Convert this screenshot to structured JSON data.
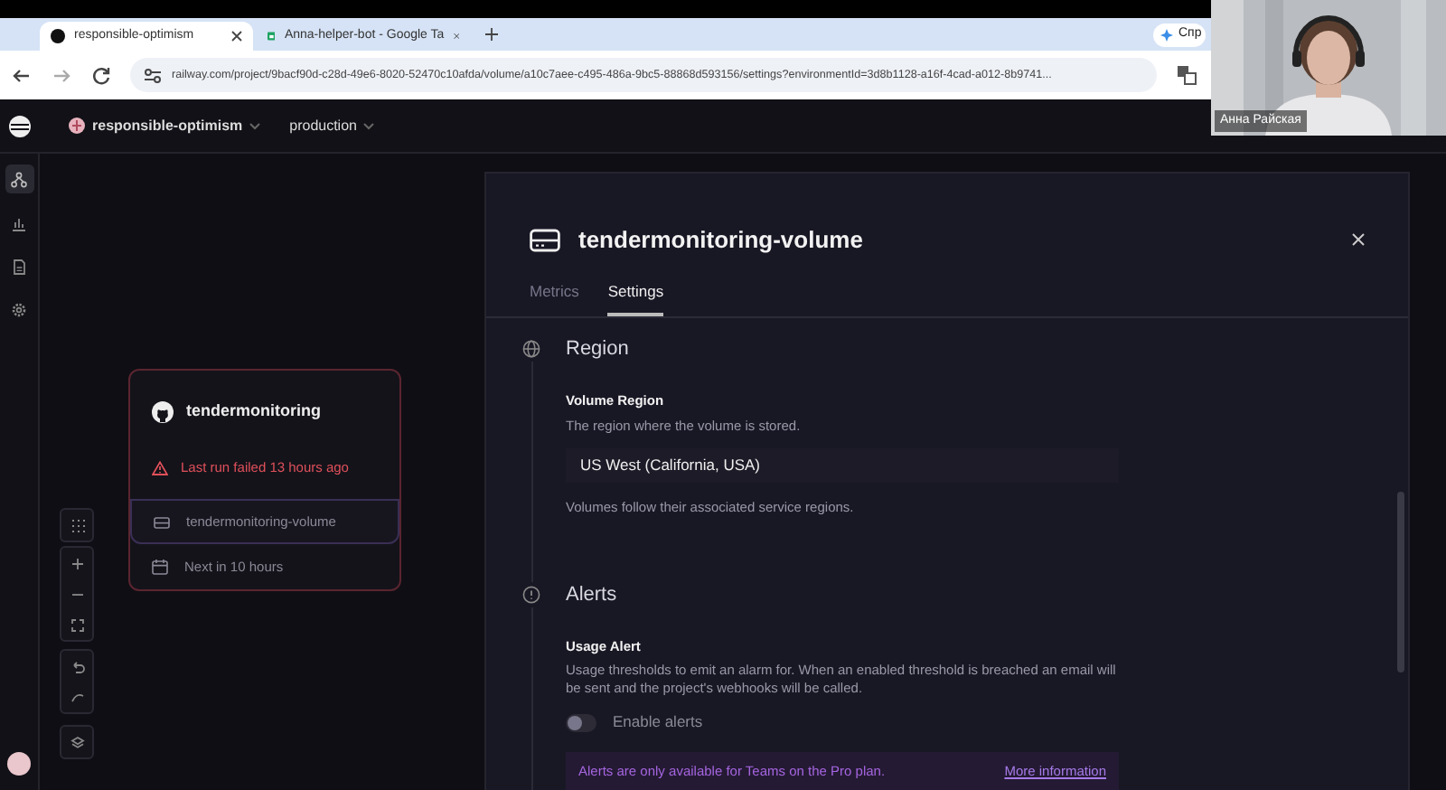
{
  "browser": {
    "tabs": [
      {
        "title": "responsible-optimism",
        "selected": true,
        "kind": "railway"
      },
      {
        "title": "Anna-helper-bot - Google Ta",
        "selected": false,
        "kind": "sheets"
      }
    ],
    "side_button": "Спр",
    "url": "railway.com/project/9bacf90d-c28d-49e6-8020-52470c10afda/volume/a10c7aee-c495-486a-9bc5-88868d593156/settings?environmentId=3d8b1128-a16f-4cad-a012-8b9741..."
  },
  "app_header": {
    "project": "responsible-optimism",
    "environment": "production"
  },
  "sidebar": {
    "items": [
      {
        "kind": "architecture",
        "selected": true
      },
      {
        "kind": "metrics",
        "selected": false
      },
      {
        "kind": "logs",
        "selected": false
      },
      {
        "kind": "settings",
        "selected": false
      }
    ]
  },
  "canvas": {
    "service": {
      "name": "tendermonitoring",
      "status": "Last run failed 13 hours ago",
      "volume": "tendermonitoring-volume",
      "schedule": "Next in 10 hours"
    }
  },
  "panel": {
    "title": "tendermonitoring-volume",
    "tabs": [
      {
        "label": "Metrics",
        "selected": false
      },
      {
        "label": "Settings",
        "selected": true
      }
    ],
    "sections": [
      {
        "kind": "region",
        "heading": "Region",
        "field_label": "Volume Region",
        "description": "The region where the volume is stored.",
        "value": "US West (California, USA)",
        "note": "Volumes follow their associated service regions."
      },
      {
        "kind": "alerts",
        "heading": "Alerts",
        "field_label": "Usage Alert",
        "description": "Usage thresholds to emit an alarm for. When an enabled threshold is breached an email will be sent and the project's webhooks will be called.",
        "toggle": {
          "label": "Enable alerts",
          "on": false
        },
        "notice": {
          "text": "Alerts are only available for Teams on the Pro plan.",
          "link": "More information"
        }
      }
    ]
  },
  "video": {
    "participant": "Анна Райская"
  }
}
